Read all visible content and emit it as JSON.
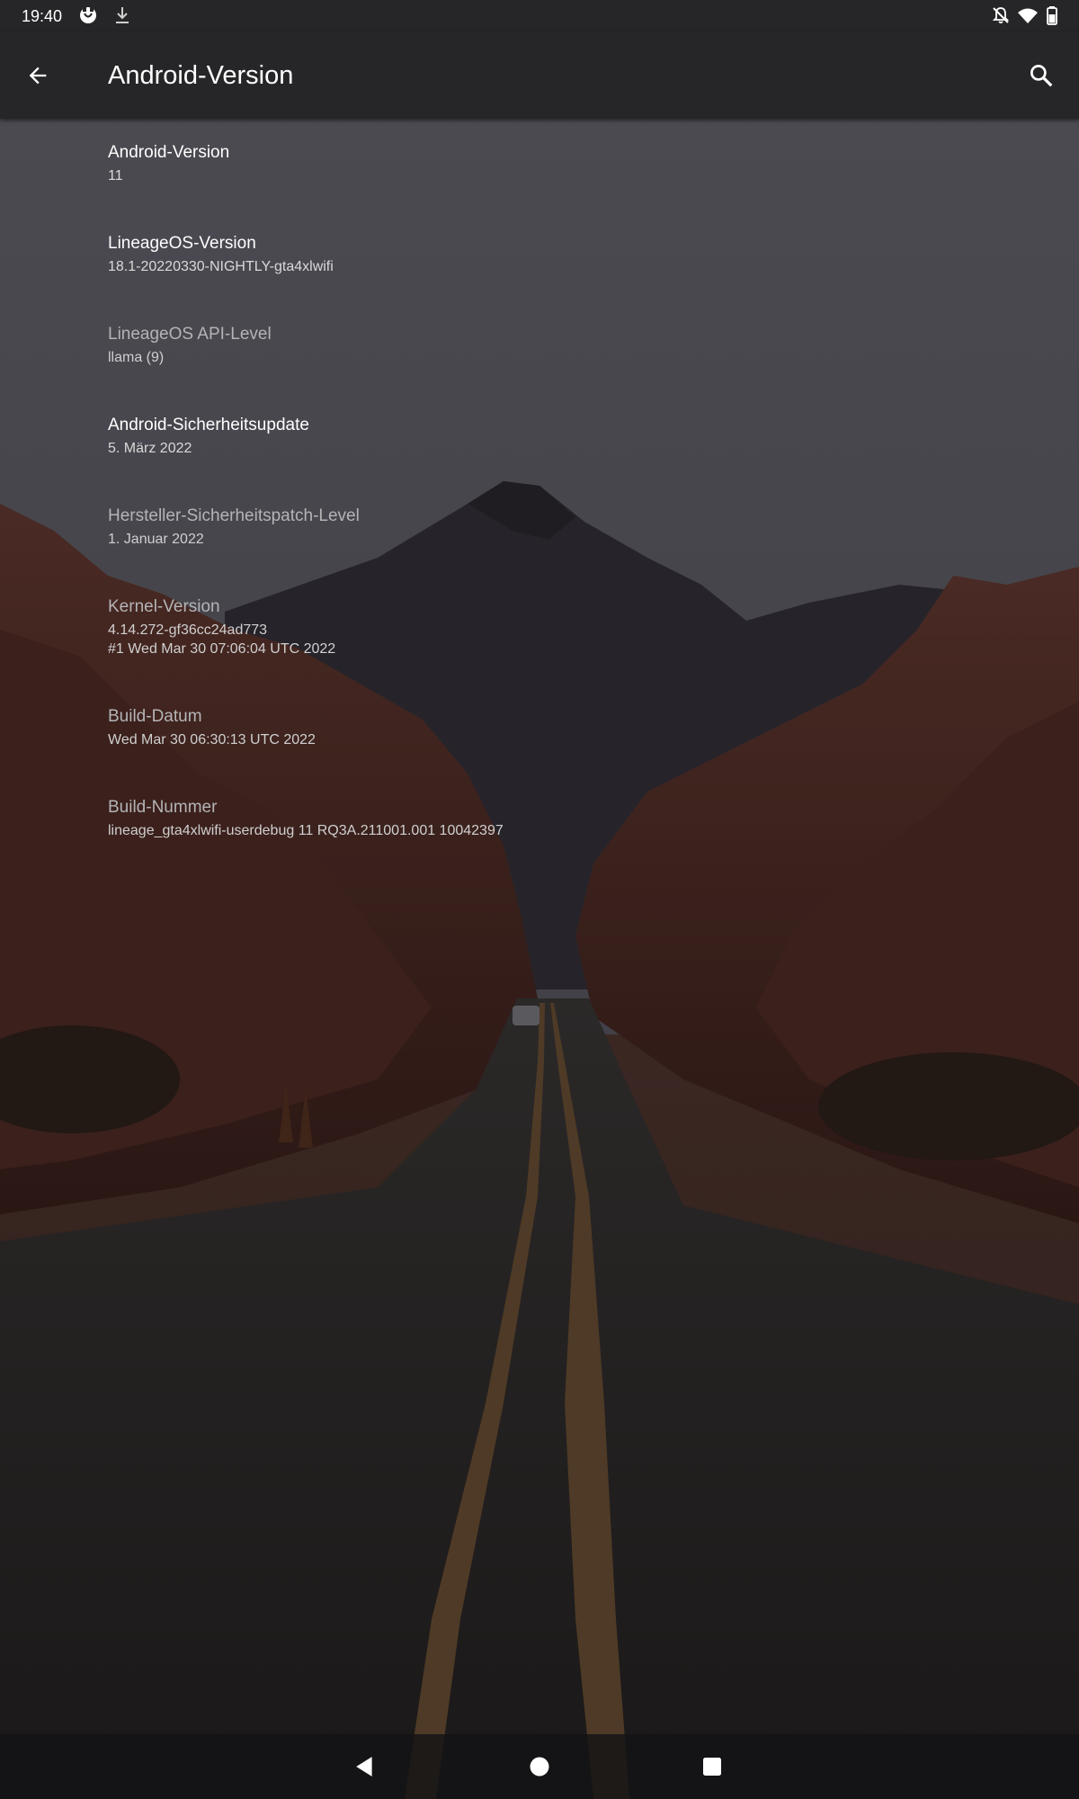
{
  "status_bar": {
    "time": "19:40",
    "left_icons": [
      "app-notification-icon",
      "download-icon"
    ],
    "right_icons": [
      "notifications-off-icon",
      "wifi-icon",
      "battery-icon"
    ]
  },
  "app_bar": {
    "title": "Android-Version",
    "back_icon": "arrow-back-icon",
    "search_icon": "search-icon"
  },
  "items": [
    {
      "title": "Android-Version",
      "summary": "11",
      "style": "bright"
    },
    {
      "title": "LineageOS-Version",
      "summary": "18.1-20220330-NIGHTLY-gta4xlwifi",
      "style": "bright"
    },
    {
      "title": "LineageOS API-Level",
      "summary": "llama (9)",
      "style": "dim"
    },
    {
      "title": "Android-Sicherheitsupdate",
      "summary": "5. März 2022",
      "style": "bright"
    },
    {
      "title": "Hersteller-Sicherheitspatch-Level",
      "summary": "1. Januar 2022",
      "style": "dim"
    },
    {
      "title": "Kernel-Version",
      "summary": "4.14.272-gf36cc24ad773\n#1 Wed Mar 30 07:06:04 UTC 2022",
      "style": "dim"
    },
    {
      "title": "Build-Datum",
      "summary": "Wed Mar 30 06:30:13 UTC 2022",
      "style": "dim"
    },
    {
      "title": "Build-Nummer",
      "summary": "lineage_gta4xlwifi-userdebug 11 RQ3A.211001.001 10042397",
      "style": "dim"
    }
  ],
  "nav_bar": {
    "icons": [
      "back-triangle-icon",
      "home-circle-icon",
      "recents-square-icon"
    ]
  },
  "colors": {
    "bar_background": "#262628",
    "text_primary": "#ffffff",
    "text_secondary": "#d9d9d9",
    "text_dim": "#b4b4b6"
  }
}
